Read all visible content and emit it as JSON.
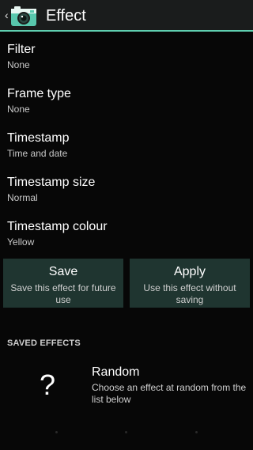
{
  "action_bar": {
    "title": "Effect",
    "back_glyph": "‹",
    "icon": "camera-app-icon",
    "accent_color": "#5fcfb0",
    "background_color": "#1a1c1c"
  },
  "preferences": [
    {
      "title": "Filter",
      "summary": "None"
    },
    {
      "title": "Frame type",
      "summary": "None"
    },
    {
      "title": "Timestamp",
      "summary": "Time and date"
    },
    {
      "title": "Timestamp size",
      "summary": "Normal"
    },
    {
      "title": "Timestamp colour",
      "summary": "Yellow"
    }
  ],
  "buttons": {
    "save": {
      "label": "Save",
      "sub": "Save this effect for future use"
    },
    "apply": {
      "label": "Apply",
      "sub": "Use this effect without saving"
    },
    "background_color": "#1f3530"
  },
  "saved_effects": {
    "header": "SAVED EFFECTS",
    "items": [
      {
        "icon_glyph": "?",
        "title": "Random",
        "description": "Choose an effect at random from the list below"
      }
    ]
  }
}
